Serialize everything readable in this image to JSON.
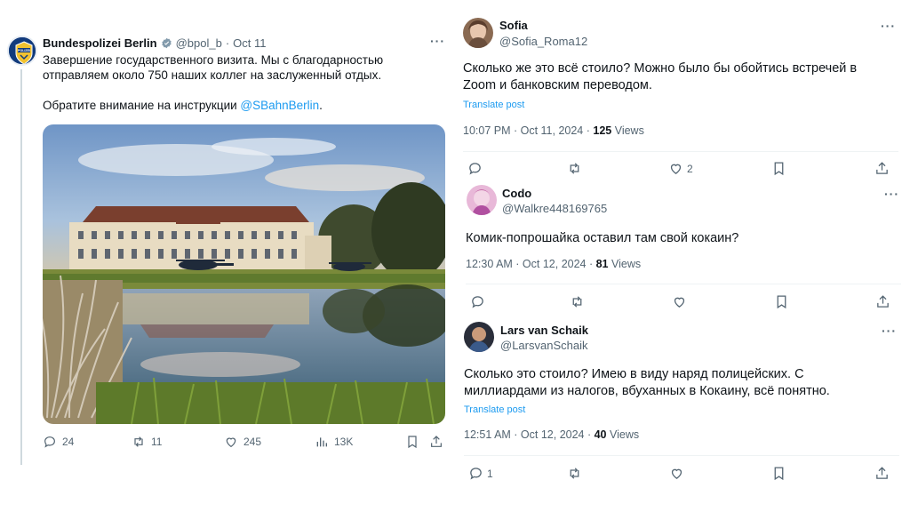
{
  "main_tweet": {
    "name": "Bundespolizei Berlin",
    "handle": "@bpol_b",
    "separator": "·",
    "date": "Oct 11",
    "text_line1": "Завершение государственного визита. Мы с благодарностью отправляем около 750 наших коллег на заслуженный отдых.",
    "text_line2_prefix": "Обратите внимание на инструкции ",
    "text_mention": "@SBahnBerlin",
    "text_line2_suffix": ".",
    "avatar_badge": "POLIZEI",
    "photo_icon": "photo-of-palace-with-helicopters",
    "actions": {
      "replies": "24",
      "retweets": "11",
      "likes": "245",
      "views": "13K"
    }
  },
  "replies": [
    {
      "name": "Sofia",
      "handle": "@Sofia_Roma12",
      "text": "Сколько же это всё стоило? Можно было бы обойтись встречей в Zoom и банковским переводом.",
      "translate": "Translate post",
      "time": "10:07 PM · Oct 11, 2024 · ",
      "views_count": "125",
      "views_label": " Views",
      "reply_count": "",
      "like_count": "2"
    },
    {
      "name": "Codo",
      "handle": "@Walkre448169765",
      "text": "Комик-попрошайка оставил там свой кокаин?",
      "translate": "",
      "time": "12:30 AM · Oct 12, 2024 · ",
      "views_count": "81",
      "views_label": " Views",
      "reply_count": "",
      "like_count": ""
    },
    {
      "name": "Lars van Schaik",
      "handle": "@LarsvanSchaik",
      "text": "Сколько это стоило? Имею в виду наряд полицейских. С миллиардами из налогов, вбуханных в Кокаину, всё понятно.",
      "translate": "Translate post",
      "time": "12:51 AM · Oct 12, 2024 · ",
      "views_count": "40",
      "views_label": " Views",
      "reply_count": "1",
      "like_count": ""
    }
  ],
  "more_label": "···",
  "colors": {
    "accent": "#1d9bf0",
    "secondary_text": "#536471",
    "primary_text": "#0f1419",
    "divider": "#eff3f4"
  }
}
